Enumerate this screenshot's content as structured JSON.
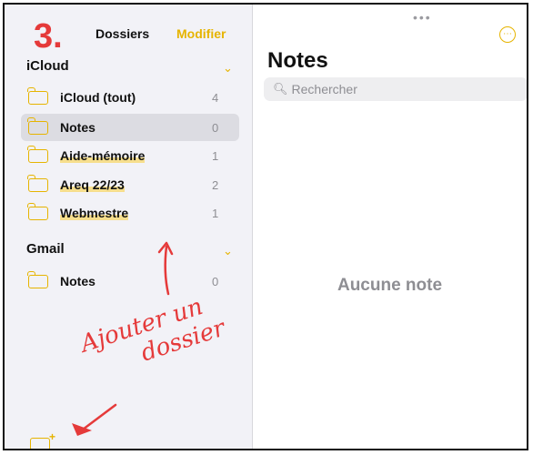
{
  "step": "3.",
  "header": {
    "title": "Dossiers",
    "edit_label": "Modifier"
  },
  "sections": [
    {
      "title": "iCloud",
      "items": [
        {
          "label": "iCloud (tout)",
          "count": "4"
        },
        {
          "label": "Notes",
          "count": "0"
        },
        {
          "label": "Aide-mémoire",
          "count": "1"
        },
        {
          "label": "Areq 22/23",
          "count": "2"
        },
        {
          "label": "Webmestre",
          "count": "1"
        }
      ]
    },
    {
      "title": "Gmail",
      "items": [
        {
          "label": "Notes",
          "count": "0"
        }
      ]
    }
  ],
  "annotation": {
    "line1": "Ajouter un",
    "line2": "dossier"
  },
  "main": {
    "grabber": "•••",
    "more_icon": "more-circle-icon",
    "title": "Notes",
    "search_placeholder": "Rechercher",
    "empty_text": "Aucune note"
  },
  "colors": {
    "accent": "#e6b400",
    "annotation": "#e53a3a",
    "highlight": "#f7d660"
  }
}
